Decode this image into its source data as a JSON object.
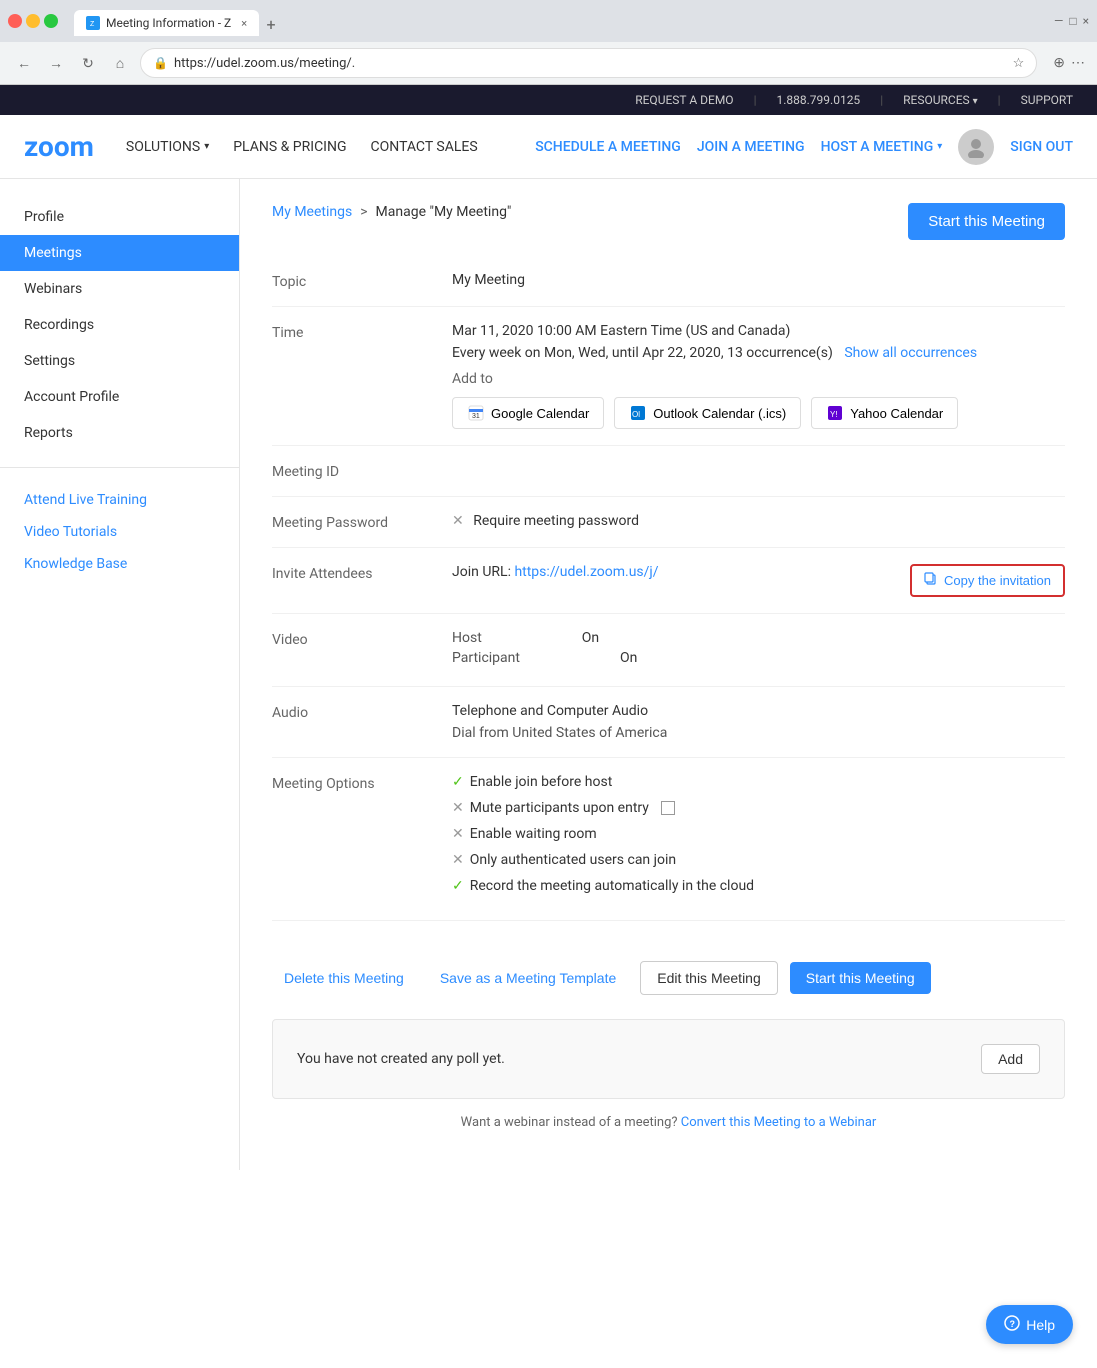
{
  "browser": {
    "tab_title": "Meeting Information - Z",
    "url": "https://udel.zoom.us/meeting/.",
    "new_tab_label": "+",
    "close_label": "×"
  },
  "topnav": {
    "request_demo": "REQUEST A DEMO",
    "phone": "1.888.799.0125",
    "resources": "RESOURCES",
    "support": "SUPPORT"
  },
  "mainnav": {
    "logo": "zoom",
    "solutions": "SOLUTIONS",
    "plans": "PLANS & PRICING",
    "contact_sales": "CONTACT SALES",
    "schedule": "SCHEDULE A MEETING",
    "join": "JOIN A MEETING",
    "host": "HOST A MEETING",
    "sign_out": "SIGN OUT"
  },
  "sidebar": {
    "profile_label": "Profile",
    "meetings_label": "Meetings",
    "webinars_label": "Webinars",
    "recordings_label": "Recordings",
    "settings_label": "Settings",
    "account_profile_label": "Account Profile",
    "reports_label": "Reports",
    "attend_training": "Attend Live Training",
    "video_tutorials": "Video Tutorials",
    "knowledge_base": "Knowledge Base"
  },
  "breadcrumb": {
    "my_meetings": "My Meetings",
    "separator": ">",
    "current": "Manage \"My Meeting\""
  },
  "header": {
    "start_btn": "Start this Meeting"
  },
  "detail": {
    "topic_label": "Topic",
    "topic_value": "My Meeting",
    "time_label": "Time",
    "time_value": "Mar 11, 2020 10:00 AM Eastern Time (US and Canada)",
    "recurrence": "Every week on Mon, Wed, until Apr 22, 2020, 13 occurrence(s)",
    "show_all": "Show all occurrences",
    "add_to_label": "Add to",
    "google_cal": "Google Calendar",
    "outlook_cal": "Outlook Calendar (.ics)",
    "yahoo_cal": "Yahoo Calendar",
    "meeting_id_label": "Meeting ID",
    "meeting_id_value": "",
    "password_label": "Meeting Password",
    "password_value": "Require meeting password",
    "invite_label": "Invite Attendees",
    "join_url_label": "Join URL:",
    "join_url": "https://udel.zoom.us/j/",
    "copy_invitation": "Copy the invitation",
    "video_label": "Video",
    "host_label": "Host",
    "host_value": "On",
    "participant_label": "Participant",
    "participant_value": "On",
    "audio_label": "Audio",
    "audio_value": "Telephone and Computer Audio",
    "dial_from": "Dial from United States of America",
    "meeting_options_label": "Meeting Options",
    "options": [
      {
        "icon": "check",
        "text": "Enable join before host"
      },
      {
        "icon": "x",
        "text": "Mute participants upon entry",
        "has_info": true
      },
      {
        "icon": "x",
        "text": "Enable waiting room"
      },
      {
        "icon": "x",
        "text": "Only authenticated users can join"
      },
      {
        "icon": "check",
        "text": "Record the meeting automatically in the cloud"
      }
    ]
  },
  "actions": {
    "delete": "Delete this Meeting",
    "save_template": "Save as a Meeting Template",
    "edit": "Edit this Meeting",
    "start": "Start this Meeting"
  },
  "poll": {
    "text": "You have not created any poll yet.",
    "add_btn": "Add"
  },
  "footer": {
    "text": "Want a webinar instead of a meeting?",
    "link": "Convert this Meeting to a Webinar"
  },
  "help": {
    "label": "Help"
  }
}
